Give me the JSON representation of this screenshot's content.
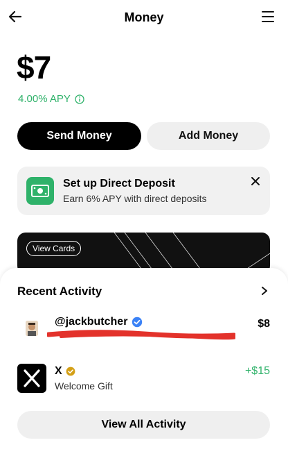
{
  "header": {
    "title": "Money"
  },
  "balance": {
    "amount": "$7",
    "apy": "4.00% APY"
  },
  "actions": {
    "send_label": "Send Money",
    "add_label": "Add Money"
  },
  "direct_deposit": {
    "title": "Set up Direct Deposit",
    "subtitle": "Earn 6% APY with direct deposits"
  },
  "card": {
    "view_cards_label": "View Cards"
  },
  "recent_activity": {
    "title": "Recent Activity",
    "items": [
      {
        "name": "@jackbutcher",
        "detail": "“",
        "amount": "$8",
        "verified_color": "#3b82f6"
      },
      {
        "name": "X",
        "detail": "Welcome Gift",
        "amount": "+$15",
        "verified_color": "#d4a017"
      }
    ],
    "view_all_label": "View All Activity"
  },
  "colors": {
    "accent_green": "#2fb26a",
    "primary_black": "#000000"
  }
}
